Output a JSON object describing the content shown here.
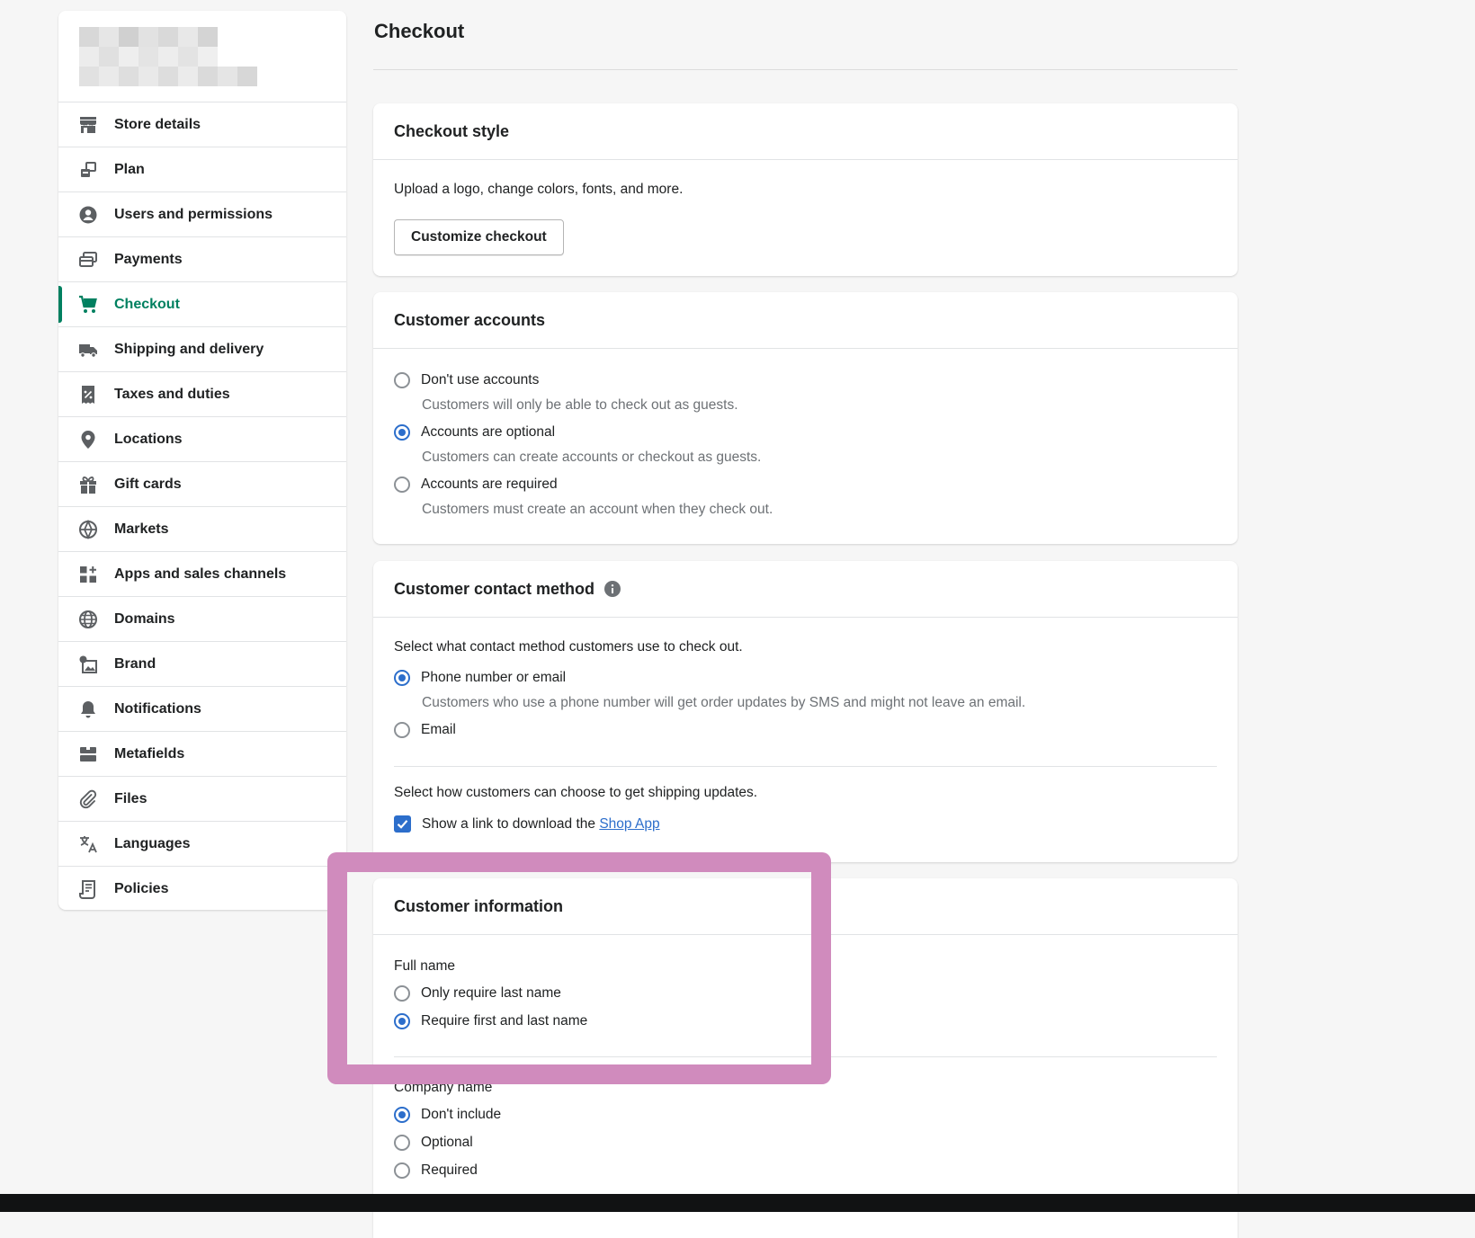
{
  "sidebar": {
    "items": [
      {
        "label": "Store details",
        "icon": "store-icon",
        "active": false
      },
      {
        "label": "Plan",
        "icon": "plan-icon",
        "active": false
      },
      {
        "label": "Users and permissions",
        "icon": "user-circle-icon",
        "active": false
      },
      {
        "label": "Payments",
        "icon": "payments-icon",
        "active": false
      },
      {
        "label": "Checkout",
        "icon": "cart-icon",
        "active": true
      },
      {
        "label": "Shipping and delivery",
        "icon": "truck-icon",
        "active": false
      },
      {
        "label": "Taxes and duties",
        "icon": "tax-receipt-icon",
        "active": false
      },
      {
        "label": "Locations",
        "icon": "location-pin-icon",
        "active": false
      },
      {
        "label": "Gift cards",
        "icon": "gift-icon",
        "active": false
      },
      {
        "label": "Markets",
        "icon": "markets-globe-icon",
        "active": false
      },
      {
        "label": "Apps and sales channels",
        "icon": "apps-icon",
        "active": false
      },
      {
        "label": "Domains",
        "icon": "domains-globe-icon",
        "active": false
      },
      {
        "label": "Brand",
        "icon": "brand-icon",
        "active": false
      },
      {
        "label": "Notifications",
        "icon": "bell-icon",
        "active": false
      },
      {
        "label": "Metafields",
        "icon": "metafields-icon",
        "active": false
      },
      {
        "label": "Files",
        "icon": "paperclip-icon",
        "active": false
      },
      {
        "label": "Languages",
        "icon": "translate-icon",
        "active": false
      },
      {
        "label": "Policies",
        "icon": "policy-document-icon",
        "active": false
      }
    ]
  },
  "page": {
    "title": "Checkout"
  },
  "checkout_style": {
    "title": "Checkout style",
    "description": "Upload a logo, change colors, fonts, and more.",
    "button": "Customize checkout"
  },
  "customer_accounts": {
    "title": "Customer accounts",
    "options": [
      {
        "label": "Don't use accounts",
        "help": "Customers will only be able to check out as guests.",
        "selected": false
      },
      {
        "label": "Accounts are optional",
        "help": "Customers can create accounts or checkout as guests.",
        "selected": true
      },
      {
        "label": "Accounts are required",
        "help": "Customers must create an account when they check out.",
        "selected": false
      }
    ]
  },
  "contact_method": {
    "title": "Customer contact method",
    "prompt": "Select what contact method customers use to check out.",
    "options": [
      {
        "label": "Phone number or email",
        "help": "Customers who use a phone number will get order updates by SMS and might not leave an email.",
        "selected": true
      },
      {
        "label": "Email",
        "selected": false
      }
    ],
    "shipping_prompt": "Select how customers can choose to get shipping updates.",
    "shop_link_text": "Show a link to download the ",
    "shop_link": "Shop App",
    "shop_checked": true
  },
  "customer_information": {
    "title": "Customer information",
    "full_name_label": "Full name",
    "full_name_options": [
      {
        "label": "Only require last name",
        "selected": false
      },
      {
        "label": "Require first and last name",
        "selected": true
      }
    ],
    "company_label": "Company name",
    "company_options": [
      {
        "label": "Don't include",
        "selected": true
      },
      {
        "label": "Optional",
        "selected": false
      },
      {
        "label": "Required",
        "selected": false
      }
    ]
  },
  "colors": {
    "accent": "#008060",
    "radio": "#2c6ecb",
    "highlight": "#d08bbd"
  }
}
